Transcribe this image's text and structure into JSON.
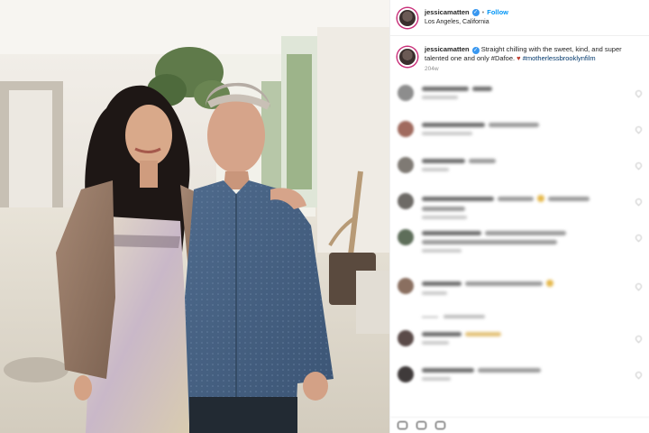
{
  "post": {
    "username": "jessicamatten",
    "follow_label": "Follow",
    "location": "Los Angeles, California",
    "caption_text": "Straight chilling with the sweet, kind, and super talented one and only #Dafoe.",
    "caption_hashtags": "#motherlessbrooklynfilm",
    "caption_time": "204w"
  },
  "icons": {
    "verified": "verified-badge-icon",
    "heart": "red-heart-emoji-icon",
    "like": "heart-outline-icon"
  },
  "colors": {
    "link_blue": "#0095f6",
    "verified_blue": "#3897f0",
    "hashtag": "#00376b",
    "text": "#262626",
    "secondary": "#8e8e8e"
  },
  "comments_blurred": true
}
